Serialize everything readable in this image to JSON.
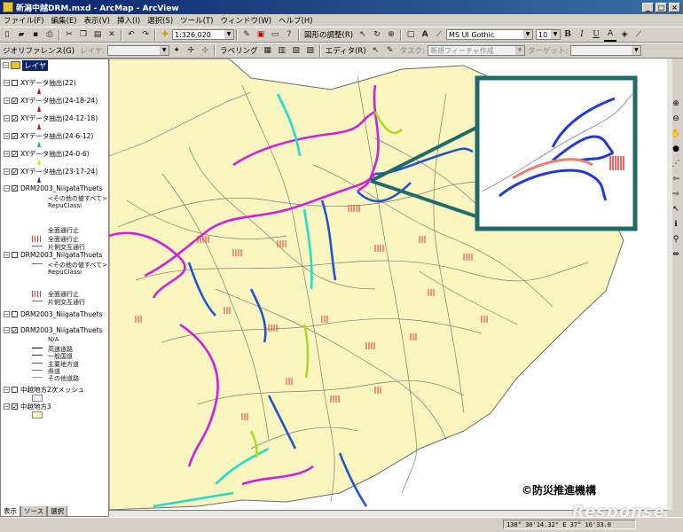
{
  "window": {
    "title": "新潟中越DRM.mxd - ArcMap - ArcView",
    "buttons": [
      "_",
      "□",
      "×"
    ]
  },
  "menu": [
    "ファイル(F)",
    "編集(E)",
    "表示(V)",
    "挿入(I)",
    "選択(S)",
    "ツール(T)",
    "ウィンドウ(W)",
    "ヘルプ(H)"
  ],
  "toolbar1": {
    "scale": "1:326,020",
    "drawing": "図形の調整(R)",
    "font": "MS UI Gothic",
    "font_size": "10",
    "bold": "B",
    "italic": "I",
    "underline": "U"
  },
  "toolbar2": {
    "georef": "ジオリファレンス(G)",
    "layer_label": "レイヤ:",
    "labeling": "ラベリング",
    "editor": "エディタ(R)",
    "task_label": "タスク:",
    "task_value": "新規フィーチャ作成",
    "target_label": "ターゲット:"
  },
  "toc": {
    "title": "レイヤ",
    "layers": [
      {
        "name": "XYデータ抽出(22)",
        "checked": false,
        "color": "#e00000"
      },
      {
        "name": "XYデータ抽出(24-18-24)",
        "checked": true,
        "color": "#e00000"
      },
      {
        "name": "XYデータ抽出(24-12-18)",
        "checked": true,
        "color": "#e00000"
      },
      {
        "name": "XYデータ抽出(24-6-12)",
        "checked": true,
        "color": "#00b0b0"
      },
      {
        "name": "XYデータ抽出(24-0-6)",
        "checked": true,
        "color": "#e0e000"
      },
      {
        "name": "XYデータ抽出(23-17-24)",
        "checked": true,
        "color": "#2020e0"
      },
      {
        "name": "DRM2003_NiigataThuets",
        "checked": true
      },
      {
        "name": "DRM2003_NiigataThuets",
        "checked": false
      },
      {
        "name": "DRM2003_NiigataThuets",
        "checked": false
      },
      {
        "name": "DRM2003_NiigataThuets",
        "checked": true
      },
      {
        "name": "中越地方2次メッシュ",
        "checked": false
      },
      {
        "name": "中越地方3",
        "checked": true
      }
    ],
    "sub": {
      "other": "<その他の値すべて>",
      "field": "RepuClassi",
      "closed_all": "全面通行止",
      "closed_full": "全面通行止",
      "one_lane": "片側交互通行",
      "other2": "<その他の値すべて>",
      "field2": "RepuClassi",
      "closed3": "全面通行止",
      "one_lane3": "片側交互通行",
      "road_na": "N/A",
      "road_expressway": "高速道路",
      "road_national": "一般国道",
      "road_main": "主要地方道",
      "road_pref": "県道",
      "road_other": "その他道路"
    },
    "tabs": [
      "表示",
      "ソース",
      "選択"
    ]
  },
  "status": {
    "coords": "138° 30'14.32\" E  37° 16'33.0"
  },
  "credit": "©防災推進機構",
  "watermark": "Response",
  "colors": {
    "land": "#fbf5c0",
    "title_start": "#0a246a",
    "inset_border": "#1f6b6b"
  }
}
